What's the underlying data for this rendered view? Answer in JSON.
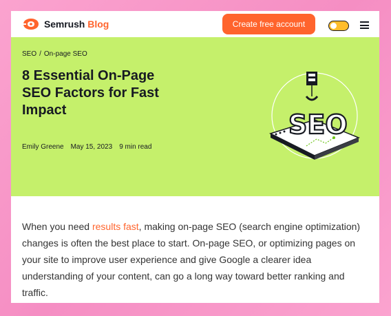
{
  "header": {
    "brand": "Semrush",
    "section": "Blog",
    "cta_label": "Create free account",
    "theme_toggle_state": "light",
    "icons": [
      "semrush-logo-icon",
      "theme-toggle",
      "hamburger-menu-icon"
    ],
    "colors": {
      "accent": "#ff642d",
      "toggle": "#ffbd2c"
    }
  },
  "hero": {
    "breadcrumb": {
      "home": "SEO",
      "separator": "/",
      "current": "On-page SEO"
    },
    "title": "8 Essential On-Page SEO Factors for Fast Impact",
    "author": "Emily Greene",
    "date": "May 15, 2023",
    "read_time": "9 min read",
    "illustration_text": "SEO",
    "background": "#c5f06b"
  },
  "article": {
    "intro_before_link": "When you need ",
    "link_text": "results fast",
    "intro_after_link": ", making on-page SEO (search engine optimization) changes is often the best place to start. On-page SEO, or optimizing pages on your site to improve user experience and give Google a clearer idea understanding of your content, can go a long way toward better ranking and traffic."
  }
}
